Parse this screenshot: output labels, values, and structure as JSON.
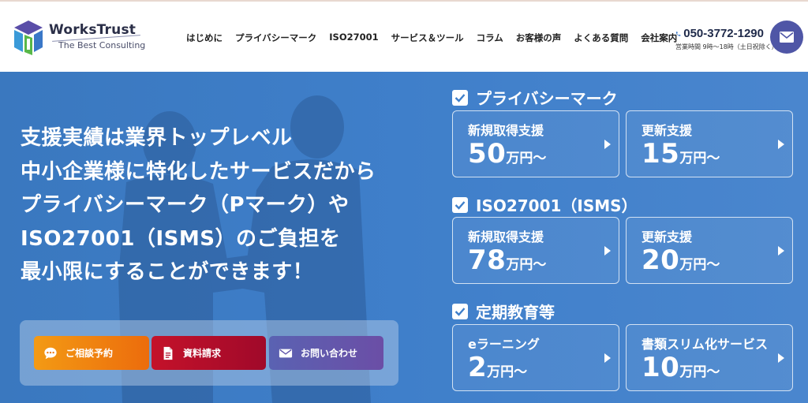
{
  "brand": {
    "name": "WorksTrust",
    "tagline": "The Best Consulting"
  },
  "nav": [
    {
      "label": "はじめに"
    },
    {
      "label": "プライバシーマーク"
    },
    {
      "label": "ISO27001"
    },
    {
      "label": "サービス＆ツール"
    },
    {
      "label": "コラム"
    },
    {
      "label": "お客様の声"
    },
    {
      "label": "よくある質問"
    },
    {
      "label": "会社案内"
    }
  ],
  "contact": {
    "phone": "050-3772-1290",
    "hours": "営業時間 9時～18時（土日祝除く）",
    "icon": "phone-icon",
    "mail_icon": "mail-icon"
  },
  "hero": {
    "headline": [
      "支援実績は業界トップレベル",
      "中小企業様に特化したサービスだから",
      "プライバシーマーク（Pマーク）や",
      "ISO27001（ISMS）のご負担を",
      "最小限にすることができます！"
    ]
  },
  "cta": [
    {
      "label": "ご相談予約",
      "icon": "chat-icon",
      "color": "#ee7a10"
    },
    {
      "label": "資料請求",
      "icon": "document-icon",
      "color": "#b20e2a"
    },
    {
      "label": "お問い合わせ",
      "icon": "mail-icon",
      "color": "#6257ac"
    }
  ],
  "pricing": [
    {
      "title": "プライバシーマーク",
      "cards": [
        {
          "title": "新規取得支援",
          "price": "50",
          "unit": "万円～"
        },
        {
          "title": "更新支援",
          "price": "15",
          "unit": "万円～"
        }
      ]
    },
    {
      "title": "ISO27001（ISMS）",
      "cards": [
        {
          "title": "新規取得支援",
          "price": "78",
          "unit": "万円～"
        },
        {
          "title": "更新支援",
          "price": "20",
          "unit": "万円～"
        }
      ]
    },
    {
      "title": "定期教育等",
      "cards": [
        {
          "title": "eラーニング",
          "price": "2",
          "unit": "万円～"
        },
        {
          "title": "書類スリム化サービス",
          "price": "10",
          "unit": "万円～"
        }
      ]
    }
  ],
  "colors": {
    "hero_bg": "#3f7fca",
    "accent": "#4f56a6",
    "text_dark": "#2b2f48"
  }
}
